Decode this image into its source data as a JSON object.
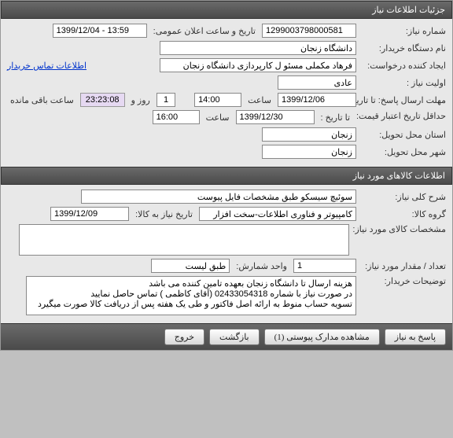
{
  "sections": {
    "need_info_header": "جزئیات اطلاعات نیاز",
    "goods_info_header": "اطلاعات کالاهای مورد نیاز"
  },
  "labels": {
    "need_number": "شماره نیاز:",
    "announce_datetime": "تاریخ و ساعت اعلان عمومی:",
    "buyer_org": "نام دستگاه خریدار:",
    "requester": "ایجاد کننده درخواست:",
    "priority": "اولیت نیاز :",
    "response_deadline": "مهلت ارسال پاسخ:  تا تاریخ :",
    "time_label": "ساعت",
    "min_validity": "حداقل تاریخ اعتبار قیمت:",
    "to_date": "تا تاریخ :",
    "delivery_state": "استان محل تحویل:",
    "delivery_city": "شهر محل تحویل:",
    "general_desc": "شرح کلی نیاز:",
    "goods_group": "گروه کالا:",
    "need_by_date": "تاریخ نیاز به کالا:",
    "goods_specs": "مشخصات کالای مورد نیاز:",
    "quantity": "تعداد / مقدار مورد نیاز:",
    "unit": "واحد شمارش:",
    "buyer_notes": "توضیحات خریدار:",
    "contact_link": "اطلاعات تماس خریدار",
    "days_word": "روز و",
    "remaining": "ساعت باقی مانده"
  },
  "values": {
    "need_number": "1299003798000581",
    "announce_datetime": "1399/12/04 - 13:59",
    "buyer_org": "دانشگاه زنجان",
    "requester": "فرهاد مکملی مسئو ل کارپردازی دانشگاه زنجان",
    "priority": "عادی",
    "response_date": "1399/12/06",
    "response_time": "14:00",
    "days_remaining": "1",
    "countdown": "23:23:08",
    "validity_date": "1399/12/30",
    "validity_time": "16:00",
    "state": "زنجان",
    "city": "زنجان",
    "general_desc": "سوئیچ سیسکو طبق مشخصات فایل پیوست",
    "goods_group": "کامپیوتر و فناوری اطلاعات-سخت افزار",
    "need_by_date": "1399/12/09",
    "goods_specs": "",
    "quantity": "1",
    "unit": "طبق لیست",
    "buyer_notes": "هزینه ارسال تا دانشگاه زنجان بعهده تامین کننده می باشد\nدر صورت نیاز با شماره 02433054318 (آقای کاظمی ) تماس حاصل نمایید\nتسویه حساب منوط به ارائه اصل فاکتور و طی یک هفته پس از دریافت کالا صورت میگیرد"
  },
  "buttons": {
    "respond": "پاسخ به نیاز",
    "attachments": "مشاهده مدارک پیوستی (1)",
    "back": "بازگشت",
    "exit": "خروج"
  }
}
